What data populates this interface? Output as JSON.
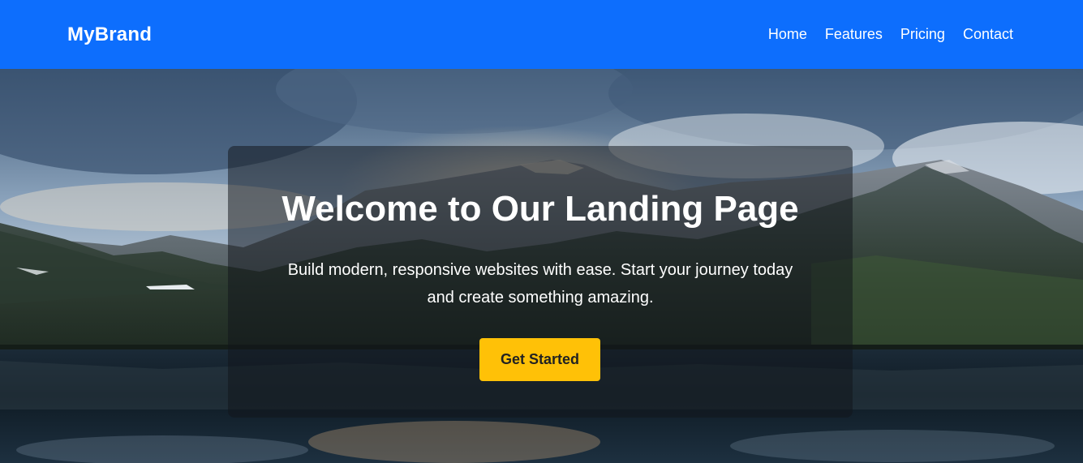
{
  "navbar": {
    "brand": "MyBrand",
    "links": [
      "Home",
      "Features",
      "Pricing",
      "Contact"
    ]
  },
  "hero": {
    "title": "Welcome to Our Landing Page",
    "subtitle_line1": "Build modern, responsive websites with ease. Start your journey today",
    "subtitle_line2": "and create something amazing.",
    "cta_label": "Get Started"
  },
  "colors": {
    "navbar_bg": "#0d6efd",
    "cta_bg": "#ffc107",
    "card_overlay": "rgba(18,22,26,0.52)"
  }
}
